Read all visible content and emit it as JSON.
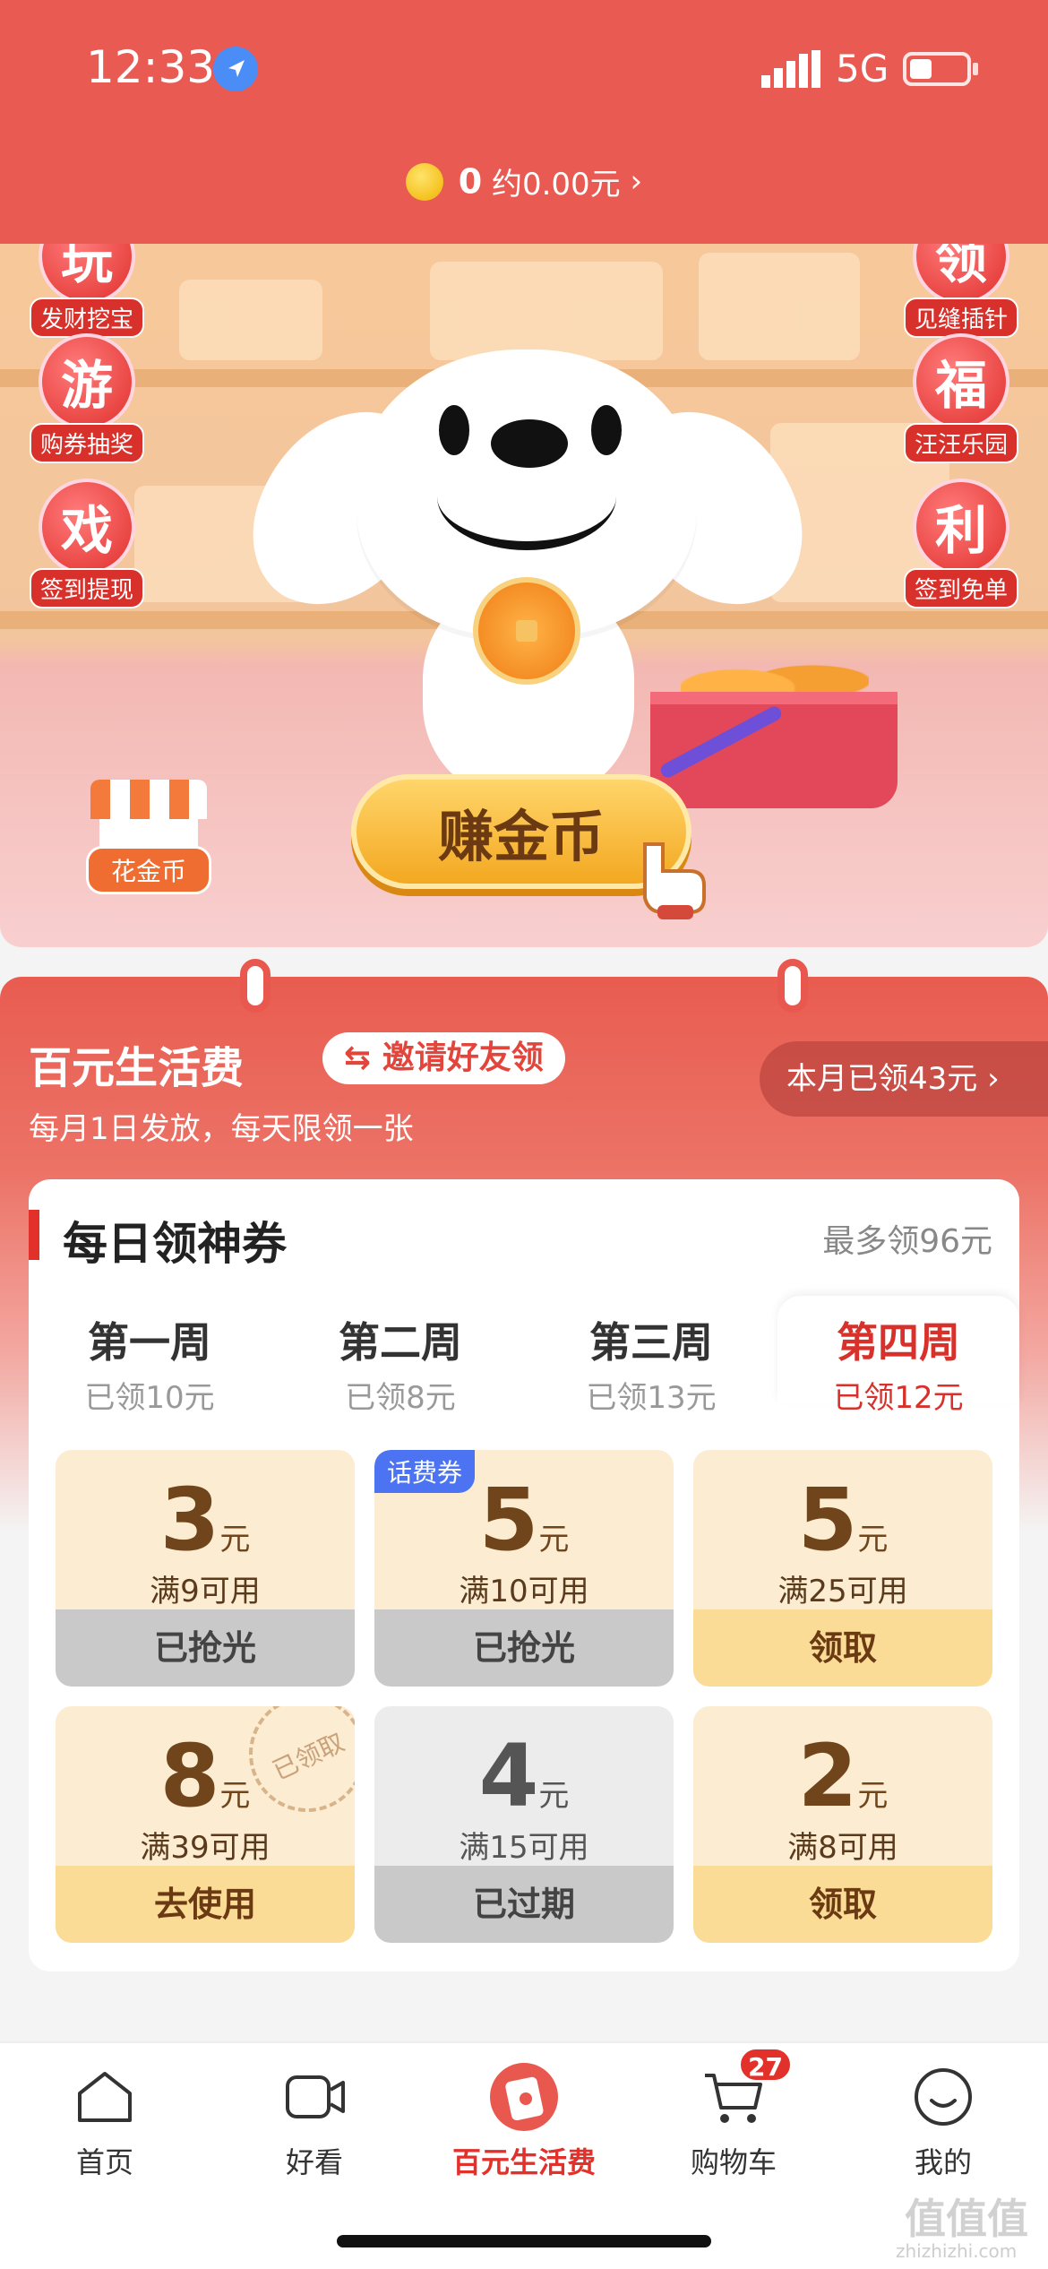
{
  "status": {
    "time": "12:33",
    "network": "5G"
  },
  "header": {
    "coin_count": "0",
    "coin_value": "约0.00元",
    "arrow": "›"
  },
  "hero": {
    "left_badges": [
      {
        "char": "玩",
        "caption": "发财挖宝"
      },
      {
        "char": "游",
        "caption": "购券抽奖"
      },
      {
        "char": "戏",
        "caption": "签到提现"
      }
    ],
    "right_badges": [
      {
        "char": "领",
        "caption": "见缝插针"
      },
      {
        "char": "福",
        "caption": "汪汪乐园"
      },
      {
        "char": "利",
        "caption": "签到免单"
      }
    ],
    "earn_button": "赚金币",
    "shop_label": "花金币"
  },
  "panel": {
    "title": "百元生活费",
    "invite": "邀请好友领",
    "subtitle": "每月1日发放，每天限领一张",
    "month_claimed": "本月已领43元 ›"
  },
  "card": {
    "title": "每日领神券",
    "max": "最多领96元",
    "weeks": [
      {
        "title": "第一周",
        "sub": "已领10元"
      },
      {
        "title": "第二周",
        "sub": "已领8元"
      },
      {
        "title": "第三周",
        "sub": "已领13元"
      },
      {
        "title": "第四周",
        "sub": "已领12元"
      }
    ],
    "coupons": [
      {
        "amount": "3",
        "unit": "元",
        "cond": "满9可用",
        "btn": "已抢光"
      },
      {
        "amount": "5",
        "unit": "元",
        "cond": "满10可用",
        "btn": "已抢光",
        "tag": "话费券"
      },
      {
        "amount": "5",
        "unit": "元",
        "cond": "满25可用",
        "btn": "领取"
      },
      {
        "amount": "8",
        "unit": "元",
        "cond": "满39可用",
        "btn": "去使用",
        "stamp": "已领取"
      },
      {
        "amount": "4",
        "unit": "元",
        "cond": "满15可用",
        "btn": "已过期"
      },
      {
        "amount": "2",
        "unit": "元",
        "cond": "满8可用",
        "btn": "领取"
      }
    ]
  },
  "tabbar": {
    "items": [
      {
        "label": "首页",
        "icon": "home-icon"
      },
      {
        "label": "好看",
        "icon": "video-icon"
      },
      {
        "label": "百元生活费",
        "icon": "life-fee-icon"
      },
      {
        "label": "购物车",
        "icon": "cart-icon"
      },
      {
        "label": "我的",
        "icon": "profile-icon"
      }
    ],
    "cart_badge": "27"
  },
  "watermark": {
    "main": "值值值",
    "sub": "zhizhizhi.com"
  },
  "colors": {
    "brand_red": "#e95a52",
    "accent_red": "#e2312b",
    "gold": "#fbdc96"
  }
}
